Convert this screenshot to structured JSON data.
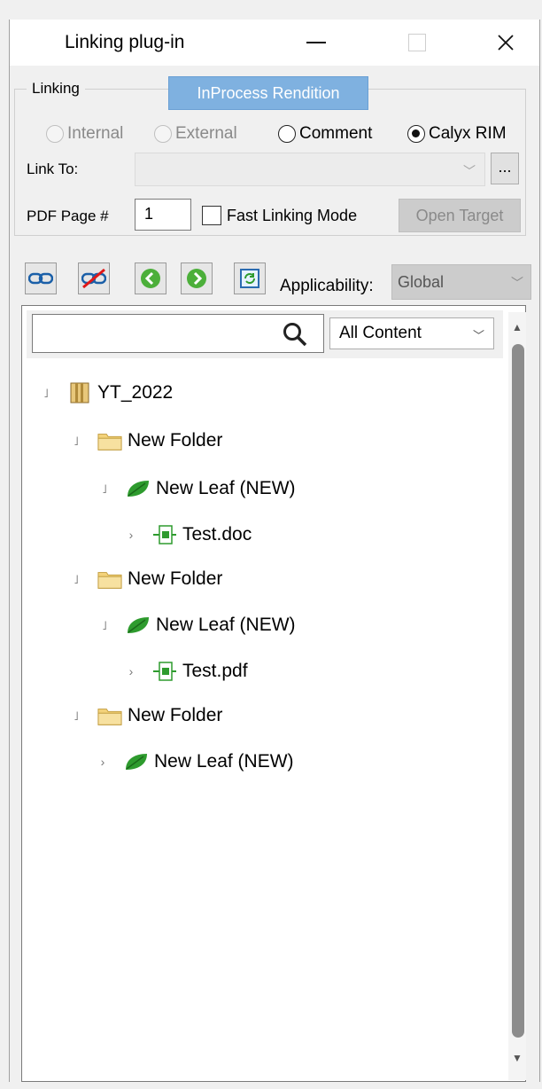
{
  "window": {
    "title": "Linking plug-in",
    "minimize_glyph": "",
    "close_glyph": "✕"
  },
  "linking": {
    "group_label": "Linking",
    "tab_label": "InProcess Rendition",
    "radios": [
      {
        "label": "Internal",
        "checked": false,
        "enabled": false
      },
      {
        "label": "External",
        "checked": false,
        "enabled": false
      },
      {
        "label": "Comment",
        "checked": false,
        "enabled": true
      },
      {
        "label": "Calyx RIM",
        "checked": true,
        "enabled": true
      }
    ],
    "link_to_label": "Link To:",
    "link_to_value": "",
    "browse_label": "...",
    "pdf_page_label": "PDF Page #",
    "pdf_page_value": "1",
    "fast_linking_label": "Fast Linking Mode",
    "fast_linking_checked": false,
    "open_target_label": "Open Target"
  },
  "toolbar": {
    "icons": [
      "link-icon",
      "unlink-icon",
      "back-arrow-icon",
      "forward-arrow-icon",
      "refresh-icon"
    ],
    "applicability_label": "Applicability:",
    "applicability_value": "Global"
  },
  "search": {
    "placeholder": "",
    "content_filter": "All Content"
  },
  "tree": [
    {
      "label": "YT_2022",
      "icon": "binder-icon",
      "level": 0,
      "expander": "expanded"
    },
    {
      "label": "New Folder",
      "icon": "folder-icon",
      "level": 1,
      "expander": "expanded"
    },
    {
      "label": "New Leaf (NEW)",
      "icon": "leaf-icon",
      "level": 2,
      "expander": "expanded"
    },
    {
      "label": "Test.doc",
      "icon": "document-icon",
      "level": 3,
      "expander": "collapsed"
    },
    {
      "label": "New Folder",
      "icon": "folder-icon",
      "level": 1,
      "expander": "expanded"
    },
    {
      "label": "New Leaf (NEW)",
      "icon": "leaf-icon",
      "level": 2,
      "expander": "expanded"
    },
    {
      "label": "Test.pdf",
      "icon": "document-icon",
      "level": 3,
      "expander": "collapsed"
    },
    {
      "label": "New Folder",
      "icon": "folder-icon",
      "level": 1,
      "expander": "expanded"
    },
    {
      "label": "New Leaf (NEW)",
      "icon": "leaf-icon",
      "level": 2,
      "expander": "collapsed"
    }
  ],
  "colors": {
    "tab_blue": "#7fb1e0",
    "leaf_green": "#2e9b2e",
    "folder_yellow": "#f3d27a"
  }
}
